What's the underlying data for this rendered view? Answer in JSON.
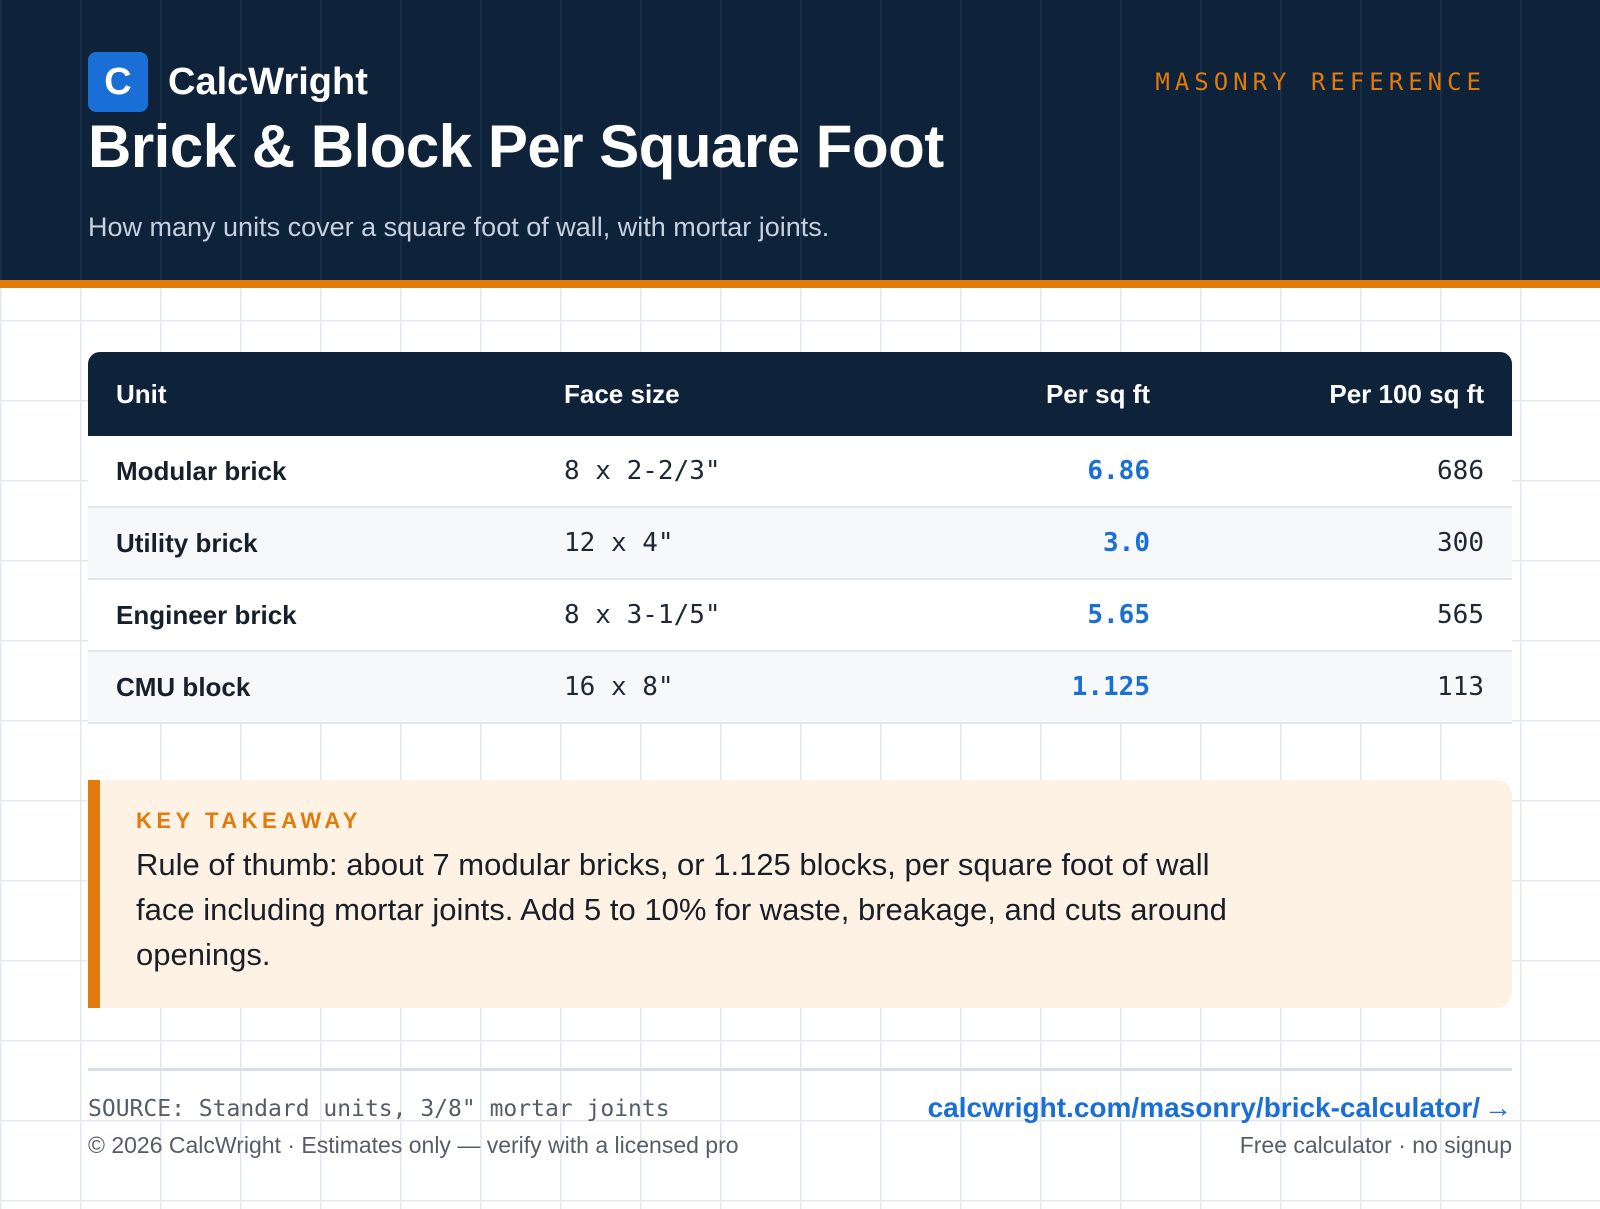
{
  "brand": {
    "logo_letter": "C",
    "name": "CalcWright"
  },
  "kicker": "MASONRY REFERENCE",
  "title": "Brick & Block Per Square Foot",
  "subtitle": "How many units cover a square foot of wall, with mortar joints.",
  "table": {
    "headers": [
      "Unit",
      "Face size",
      "Per sq ft",
      "Per 100 sq ft"
    ],
    "rows": [
      {
        "unit": "Modular brick",
        "face": "8 x 2-2/3\"",
        "per_sqft": "6.86",
        "per_100": "686"
      },
      {
        "unit": "Utility brick",
        "face": "12 x 4\"",
        "per_sqft": "3.0",
        "per_100": "300"
      },
      {
        "unit": "Engineer brick",
        "face": "8 x 3-1/5\"",
        "per_sqft": "5.65",
        "per_100": "565"
      },
      {
        "unit": "CMU block",
        "face": "16 x 8\"",
        "per_sqft": "1.125",
        "per_100": "113"
      }
    ]
  },
  "takeaway": {
    "label": "KEY TAKEAWAY",
    "text": "Rule of thumb: about 7 modular bricks, or 1.125 blocks, per square foot of wall face including mortar joints. Add 5 to 10% for waste, breakage, and cuts around openings."
  },
  "footer": {
    "source": "SOURCE: Standard units, 3/8\" mortar joints",
    "copyright": "© 2026 CalcWright · Estimates only — verify with a licensed pro",
    "link": "calcwright.com/masonry/brick-calculator/",
    "arrow": "→",
    "cta_note": "Free calculator · no signup"
  },
  "colors": {
    "header_bg": "#0e223a",
    "accent_orange": "#e07b0c",
    "accent_blue": "#1a6fd6",
    "takeaway_bg": "#fef2e4"
  },
  "icons": {
    "logo": "calcwright-logo-icon",
    "link_arrow": "arrow-right-icon"
  }
}
